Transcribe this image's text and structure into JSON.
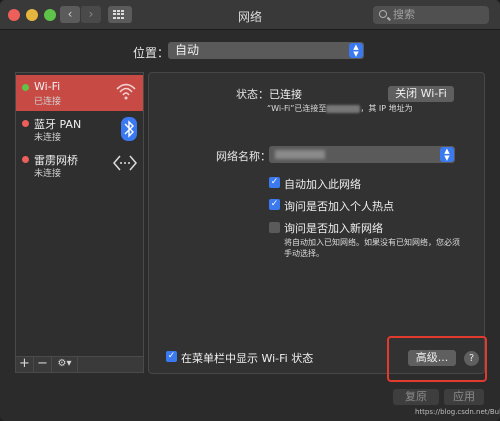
{
  "window": {
    "title": "网络"
  },
  "search": {
    "placeholder": "搜索"
  },
  "location": {
    "label": "位置：",
    "value": "自动"
  },
  "services": [
    {
      "name": "Wi-Fi",
      "status": "已连接",
      "dot": "#5ec349",
      "icon": "wifi-icon"
    },
    {
      "name": "蓝牙 PAN",
      "status": "未连接",
      "dot": "#ec5f5a",
      "icon": "bluetooth-icon"
    },
    {
      "name": "雷雳网桥",
      "status": "未连接",
      "dot": "#ec5f5a",
      "icon": "thunderbolt-bridge-icon"
    }
  ],
  "sidebar_tools": {
    "add": "+",
    "remove": "−",
    "gear": "⚙▾"
  },
  "detail": {
    "status_label": "状态：",
    "status_value": "已连接",
    "turn_off_button": "关闭 Wi-Fi",
    "status_desc_prefix": "“Wi-Fi”已连接至",
    "status_desc_suffix": "，其 IP 地址为",
    "network_name_label": "网络名称：",
    "auto_join_label": "自动加入此网络",
    "ask_hotspot_label": "询问是否加入个人热点",
    "ask_new_label": "询问是否加入新网络",
    "ask_new_desc_1": "将自动加入已知网络。如果没有已知网络，您必须",
    "ask_new_desc_2": "手动选择。",
    "show_menu_label": "在菜单栏中显示 Wi-Fi 状态",
    "advanced_button": "高级...",
    "help": "?"
  },
  "footer": {
    "revert": "复原",
    "apply": "应用"
  },
  "watermark": "https://blog.csdn.net/Bule_daze",
  "colors": {
    "accent": "#3b79f0",
    "selection": "#c84a45",
    "highlight_box": "#e23a2c"
  }
}
